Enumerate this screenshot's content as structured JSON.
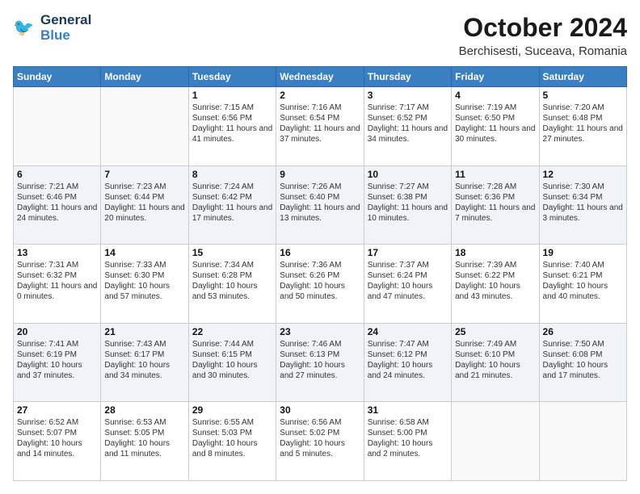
{
  "header": {
    "logo_line1": "General",
    "logo_line2": "Blue",
    "month": "October 2024",
    "location": "Berchisesti, Suceava, Romania"
  },
  "days_of_week": [
    "Sunday",
    "Monday",
    "Tuesday",
    "Wednesday",
    "Thursday",
    "Friday",
    "Saturday"
  ],
  "weeks": [
    [
      {
        "day": "",
        "empty": true
      },
      {
        "day": "",
        "empty": true
      },
      {
        "day": "1",
        "sunrise": "Sunrise: 7:15 AM",
        "sunset": "Sunset: 6:56 PM",
        "daylight": "Daylight: 11 hours and 41 minutes."
      },
      {
        "day": "2",
        "sunrise": "Sunrise: 7:16 AM",
        "sunset": "Sunset: 6:54 PM",
        "daylight": "Daylight: 11 hours and 37 minutes."
      },
      {
        "day": "3",
        "sunrise": "Sunrise: 7:17 AM",
        "sunset": "Sunset: 6:52 PM",
        "daylight": "Daylight: 11 hours and 34 minutes."
      },
      {
        "day": "4",
        "sunrise": "Sunrise: 7:19 AM",
        "sunset": "Sunset: 6:50 PM",
        "daylight": "Daylight: 11 hours and 30 minutes."
      },
      {
        "day": "5",
        "sunrise": "Sunrise: 7:20 AM",
        "sunset": "Sunset: 6:48 PM",
        "daylight": "Daylight: 11 hours and 27 minutes."
      }
    ],
    [
      {
        "day": "6",
        "sunrise": "Sunrise: 7:21 AM",
        "sunset": "Sunset: 6:46 PM",
        "daylight": "Daylight: 11 hours and 24 minutes."
      },
      {
        "day": "7",
        "sunrise": "Sunrise: 7:23 AM",
        "sunset": "Sunset: 6:44 PM",
        "daylight": "Daylight: 11 hours and 20 minutes."
      },
      {
        "day": "8",
        "sunrise": "Sunrise: 7:24 AM",
        "sunset": "Sunset: 6:42 PM",
        "daylight": "Daylight: 11 hours and 17 minutes."
      },
      {
        "day": "9",
        "sunrise": "Sunrise: 7:26 AM",
        "sunset": "Sunset: 6:40 PM",
        "daylight": "Daylight: 11 hours and 13 minutes."
      },
      {
        "day": "10",
        "sunrise": "Sunrise: 7:27 AM",
        "sunset": "Sunset: 6:38 PM",
        "daylight": "Daylight: 11 hours and 10 minutes."
      },
      {
        "day": "11",
        "sunrise": "Sunrise: 7:28 AM",
        "sunset": "Sunset: 6:36 PM",
        "daylight": "Daylight: 11 hours and 7 minutes."
      },
      {
        "day": "12",
        "sunrise": "Sunrise: 7:30 AM",
        "sunset": "Sunset: 6:34 PM",
        "daylight": "Daylight: 11 hours and 3 minutes."
      }
    ],
    [
      {
        "day": "13",
        "sunrise": "Sunrise: 7:31 AM",
        "sunset": "Sunset: 6:32 PM",
        "daylight": "Daylight: 11 hours and 0 minutes."
      },
      {
        "day": "14",
        "sunrise": "Sunrise: 7:33 AM",
        "sunset": "Sunset: 6:30 PM",
        "daylight": "Daylight: 10 hours and 57 minutes."
      },
      {
        "day": "15",
        "sunrise": "Sunrise: 7:34 AM",
        "sunset": "Sunset: 6:28 PM",
        "daylight": "Daylight: 10 hours and 53 minutes."
      },
      {
        "day": "16",
        "sunrise": "Sunrise: 7:36 AM",
        "sunset": "Sunset: 6:26 PM",
        "daylight": "Daylight: 10 hours and 50 minutes."
      },
      {
        "day": "17",
        "sunrise": "Sunrise: 7:37 AM",
        "sunset": "Sunset: 6:24 PM",
        "daylight": "Daylight: 10 hours and 47 minutes."
      },
      {
        "day": "18",
        "sunrise": "Sunrise: 7:39 AM",
        "sunset": "Sunset: 6:22 PM",
        "daylight": "Daylight: 10 hours and 43 minutes."
      },
      {
        "day": "19",
        "sunrise": "Sunrise: 7:40 AM",
        "sunset": "Sunset: 6:21 PM",
        "daylight": "Daylight: 10 hours and 40 minutes."
      }
    ],
    [
      {
        "day": "20",
        "sunrise": "Sunrise: 7:41 AM",
        "sunset": "Sunset: 6:19 PM",
        "daylight": "Daylight: 10 hours and 37 minutes."
      },
      {
        "day": "21",
        "sunrise": "Sunrise: 7:43 AM",
        "sunset": "Sunset: 6:17 PM",
        "daylight": "Daylight: 10 hours and 34 minutes."
      },
      {
        "day": "22",
        "sunrise": "Sunrise: 7:44 AM",
        "sunset": "Sunset: 6:15 PM",
        "daylight": "Daylight: 10 hours and 30 minutes."
      },
      {
        "day": "23",
        "sunrise": "Sunrise: 7:46 AM",
        "sunset": "Sunset: 6:13 PM",
        "daylight": "Daylight: 10 hours and 27 minutes."
      },
      {
        "day": "24",
        "sunrise": "Sunrise: 7:47 AM",
        "sunset": "Sunset: 6:12 PM",
        "daylight": "Daylight: 10 hours and 24 minutes."
      },
      {
        "day": "25",
        "sunrise": "Sunrise: 7:49 AM",
        "sunset": "Sunset: 6:10 PM",
        "daylight": "Daylight: 10 hours and 21 minutes."
      },
      {
        "day": "26",
        "sunrise": "Sunrise: 7:50 AM",
        "sunset": "Sunset: 6:08 PM",
        "daylight": "Daylight: 10 hours and 17 minutes."
      }
    ],
    [
      {
        "day": "27",
        "sunrise": "Sunrise: 6:52 AM",
        "sunset": "Sunset: 5:07 PM",
        "daylight": "Daylight: 10 hours and 14 minutes."
      },
      {
        "day": "28",
        "sunrise": "Sunrise: 6:53 AM",
        "sunset": "Sunset: 5:05 PM",
        "daylight": "Daylight: 10 hours and 11 minutes."
      },
      {
        "day": "29",
        "sunrise": "Sunrise: 6:55 AM",
        "sunset": "Sunset: 5:03 PM",
        "daylight": "Daylight: 10 hours and 8 minutes."
      },
      {
        "day": "30",
        "sunrise": "Sunrise: 6:56 AM",
        "sunset": "Sunset: 5:02 PM",
        "daylight": "Daylight: 10 hours and 5 minutes."
      },
      {
        "day": "31",
        "sunrise": "Sunrise: 6:58 AM",
        "sunset": "Sunset: 5:00 PM",
        "daylight": "Daylight: 10 hours and 2 minutes."
      },
      {
        "day": "",
        "empty": true
      },
      {
        "day": "",
        "empty": true
      }
    ]
  ]
}
